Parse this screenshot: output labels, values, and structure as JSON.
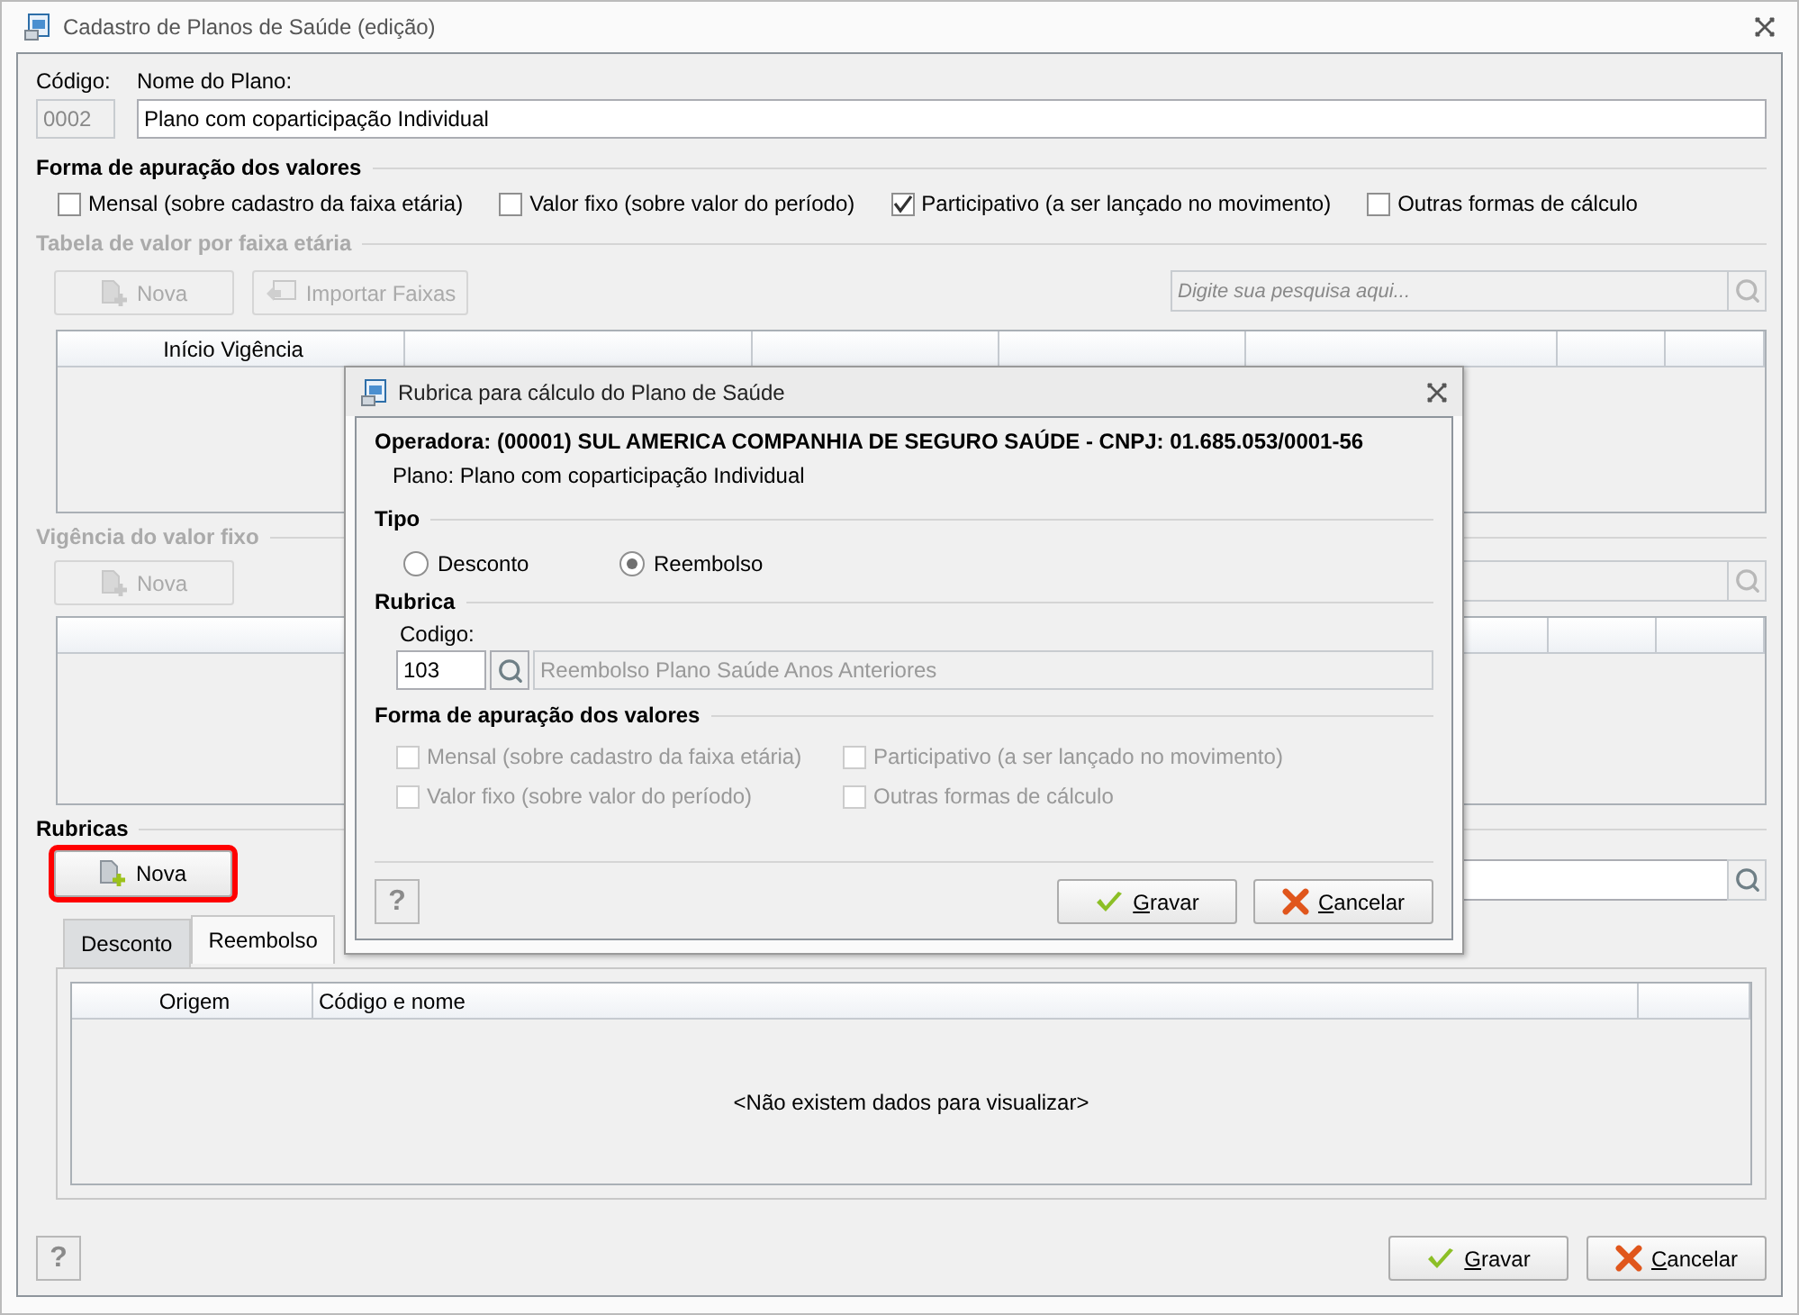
{
  "window": {
    "title": "Cadastro de Planos de Saúde (edição)"
  },
  "header": {
    "code_label": "Código:",
    "code_value": "0002",
    "name_label": "Nome do Plano:",
    "name_value": "Plano com coparticipação Individual"
  },
  "valuation": {
    "title": "Forma de apuração dos valores",
    "options": [
      {
        "label": "Mensal (sobre cadastro da faixa etária)",
        "checked": false
      },
      {
        "label": "Valor fixo (sobre valor do período)",
        "checked": false
      },
      {
        "label": "Participativo (a ser lançado no movimento)",
        "checked": true
      },
      {
        "label": "Outras formas de cálculo",
        "checked": false
      }
    ]
  },
  "age_table": {
    "title": "Tabela de valor por faixa etária",
    "disabled": true,
    "new_button": "Nova",
    "import_button": "Importar Faixas",
    "search_placeholder": "Digite sua pesquisa aqui...",
    "columns": [
      "Início Vigência"
    ]
  },
  "fixed_value": {
    "title": "Vigência do valor fixo",
    "disabled": true,
    "new_button": "Nova"
  },
  "rubricas": {
    "title": "Rubricas",
    "new_button": {
      "label": "Nova",
      "highlighted": true
    },
    "tabs": [
      {
        "label": "Desconto",
        "selected": false
      },
      {
        "label": "Reembolso",
        "selected": true
      }
    ],
    "columns": [
      "Origem",
      "Código e nome"
    ],
    "empty_message": "<Não existem dados para visualizar>"
  },
  "footer": {
    "help": "?",
    "buttons": [
      {
        "label": "Gravar",
        "kind": "confirm"
      },
      {
        "label": "Cancelar",
        "kind": "cancel"
      }
    ]
  },
  "dialog": {
    "title": "Rubrica para cálculo do Plano de Saúde",
    "operator": "Operadora: (00001) SUL AMERICA COMPANHIA DE SEGURO SAÚDE - CNPJ: 01.685.053/0001-56",
    "plan": "Plano: Plano com coparticipação Individual",
    "type_title": "Tipo",
    "types": [
      {
        "label": "Desconto",
        "selected": false
      },
      {
        "label": "Reembolso",
        "selected": true
      }
    ],
    "rubrica_title": "Rubrica",
    "code_label": "Codigo:",
    "code_value": "103",
    "description": "Reembolso Plano Saúde Anos Anteriores",
    "valuation_title": "Forma de apuração dos valores",
    "options": [
      {
        "label": "Mensal (sobre cadastro da faixa etária)",
        "checked": false,
        "disabled": true
      },
      {
        "label": "Participativo (a ser lançado no movimento)",
        "checked": false,
        "disabled": true
      },
      {
        "label": "Valor fixo (sobre valor do período)",
        "checked": false,
        "disabled": true
      },
      {
        "label": "Outras formas de cálculo",
        "checked": false,
        "disabled": true
      }
    ],
    "help": "?",
    "buttons": [
      {
        "label": "Gravar",
        "kind": "confirm"
      },
      {
        "label": "Cancelar",
        "kind": "cancel"
      }
    ]
  }
}
